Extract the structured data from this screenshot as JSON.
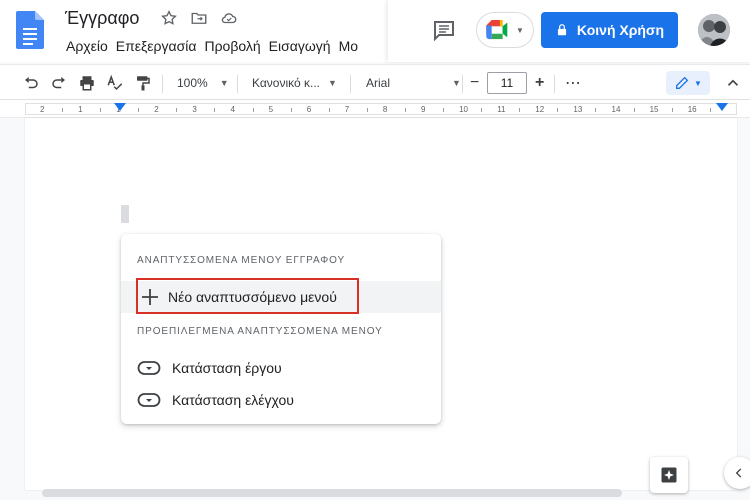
{
  "header": {
    "doc_title": "Έγγραφο",
    "menu": [
      "Αρχείο",
      "Επεξεργασία",
      "Προβολή",
      "Εισαγωγή",
      "Μο"
    ],
    "share_label": "Κοινή Χρήση"
  },
  "toolbar": {
    "zoom": "100%",
    "style": "Κανονικό κ...",
    "font": "Arial",
    "minus": "−",
    "font_size": "11",
    "plus": "+",
    "more": "⋯"
  },
  "ruler": {
    "numbers": [
      "2",
      "1",
      "1",
      "2",
      "3",
      "4",
      "5",
      "6",
      "7",
      "8",
      "9",
      "10",
      "11",
      "12",
      "13",
      "14",
      "15",
      "16"
    ]
  },
  "dropdown": {
    "section1": "ΑΝΑΠΤΥΣΣΟΜΕΝΑ ΜΕΝΟΥ ΕΓΓΡΑΦΟΥ",
    "new_item": "Νέο αναπτυσσόμενο μενού",
    "section2": "ΠΡΟΕΠΙΛΕΓΜΕΝΑ ΑΝΑΠΤΥΣΣΟΜΕΝΑ ΜΕΝΟΥ",
    "presets": [
      "Κατάσταση έργου",
      "Κατάσταση ελέγχου"
    ]
  },
  "colors": {
    "accent": "#1a73e8",
    "highlight_border": "#d93025"
  }
}
